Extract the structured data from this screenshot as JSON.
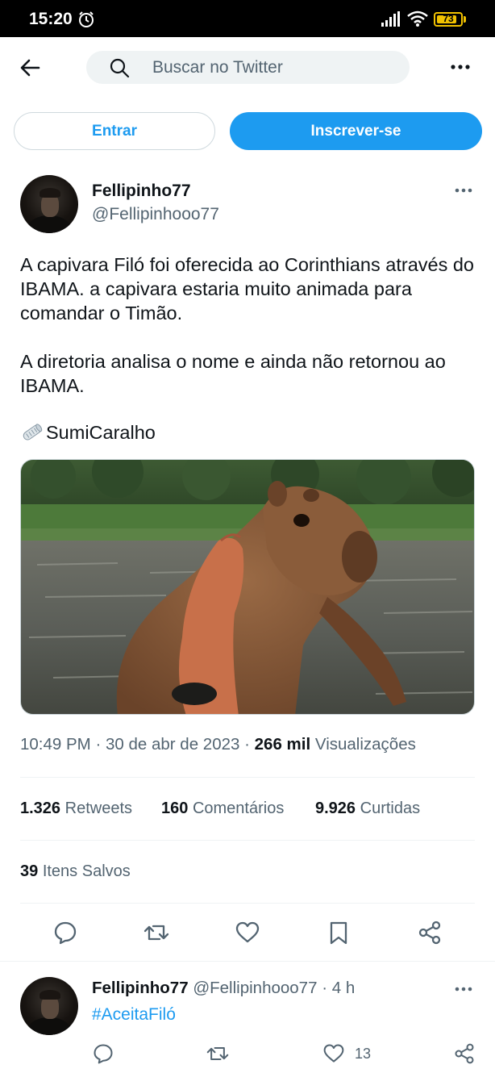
{
  "status_bar": {
    "time": "15:20",
    "battery": "73"
  },
  "top_bar": {
    "search_placeholder": "Buscar no Twitter"
  },
  "auth": {
    "login_label": "Entrar",
    "signup_label": "Inscrever-se"
  },
  "tweet": {
    "author_name": "Fellipinho77",
    "author_handle": "@Fellipinhooo77",
    "text_paragraph_1": "A capivara Filó foi oferecida ao Corinthians através do IBAMA. a capivara estaria muito animada para comandar o Timão.",
    "text_paragraph_2": "A diretoria analisa o nome e ainda não retornou ao IBAMA.",
    "hashtag_text": "SumiCaralho",
    "time": "10:49 PM",
    "date": "30 de abr de 2023",
    "views_count": "266 mil",
    "views_label": "Visualizações",
    "retweets_count": "1.326",
    "retweets_label": "Retweets",
    "comments_count": "160",
    "comments_label": "Comentários",
    "likes_count": "9.926",
    "likes_label": "Curtidas",
    "saved_count": "39",
    "saved_label": "Itens Salvos"
  },
  "reply": {
    "author_name": "Fellipinho77",
    "author_handle": "@Fellipinhooo77",
    "separator": "·",
    "age": "4 h",
    "text": "#AceitaFiló",
    "like_count": "13"
  },
  "colors": {
    "accent": "#1d9bf0",
    "text_primary": "#0f1419",
    "text_secondary": "#536471",
    "divider": "#eff3f4"
  }
}
